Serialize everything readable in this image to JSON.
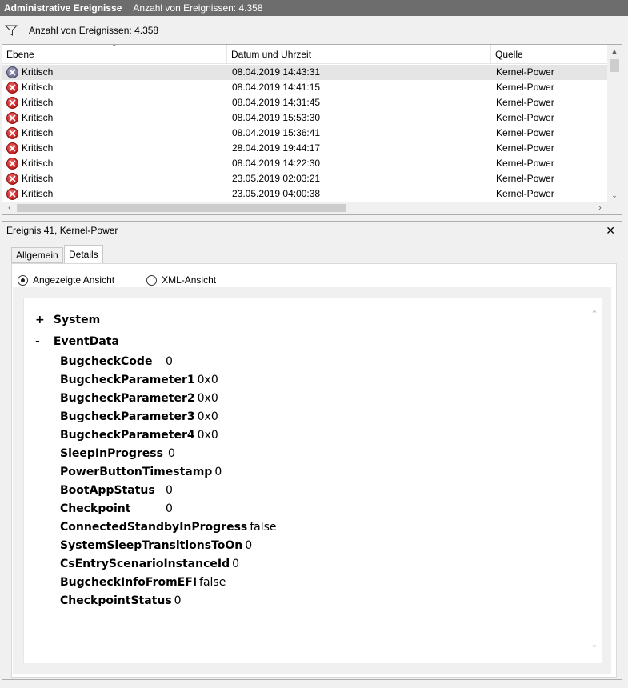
{
  "titlebar": {
    "title": "Administrative Ereignisse",
    "count": "Anzahl von Ereignissen: 4.358"
  },
  "filter": {
    "text": "Anzahl von Ereignissen: 4.358"
  },
  "columns": {
    "level": "Ebene",
    "datetime": "Datum und Uhrzeit",
    "source": "Quelle"
  },
  "rows": [
    {
      "level": "Kritisch",
      "datetime": "08.04.2019 14:43:31",
      "source": "Kernel-Power"
    },
    {
      "level": "Kritisch",
      "datetime": "08.04.2019 14:41:15",
      "source": "Kernel-Power"
    },
    {
      "level": "Kritisch",
      "datetime": "08.04.2019 14:31:45",
      "source": "Kernel-Power"
    },
    {
      "level": "Kritisch",
      "datetime": "08.04.2019 15:53:30",
      "source": "Kernel-Power"
    },
    {
      "level": "Kritisch",
      "datetime": "08.04.2019 15:36:41",
      "source": "Kernel-Power"
    },
    {
      "level": "Kritisch",
      "datetime": "28.04.2019 19:44:17",
      "source": "Kernel-Power"
    },
    {
      "level": "Kritisch",
      "datetime": "08.04.2019 14:22:30",
      "source": "Kernel-Power"
    },
    {
      "level": "Kritisch",
      "datetime": "23.05.2019 02:03:21",
      "source": "Kernel-Power"
    },
    {
      "level": "Kritisch",
      "datetime": "23.05.2019 04:00:38",
      "source": "Kernel-Power"
    }
  ],
  "detail": {
    "header": "Ereignis 41, Kernel-Power",
    "tabs": {
      "general": "Allgemein",
      "details": "Details"
    },
    "radio_friendly": "Angezeigte Ansicht",
    "radio_xml": "XML-Ansicht",
    "tree": {
      "system": {
        "sign": "+",
        "label": "System"
      },
      "eventdata": {
        "sign": "-",
        "label": "EventData"
      }
    },
    "eventdata": [
      {
        "key": "BugcheckCode",
        "value": "0"
      },
      {
        "key": "BugcheckParameter1",
        "value": "0x0"
      },
      {
        "key": "BugcheckParameter2",
        "value": "0x0"
      },
      {
        "key": "BugcheckParameter3",
        "value": "0x0"
      },
      {
        "key": "BugcheckParameter4",
        "value": "0x0"
      },
      {
        "key": "SleepInProgress",
        "value": "0"
      },
      {
        "key": "PowerButtonTimestamp",
        "value": "0"
      },
      {
        "key": "BootAppStatus",
        "value": "0"
      },
      {
        "key": "Checkpoint",
        "value": "0"
      },
      {
        "key": "ConnectedStandbyInProgress",
        "value": "false"
      },
      {
        "key": "SystemSleepTransitionsToOn",
        "value": "0"
      },
      {
        "key": "CsEntryScenarioInstanceId",
        "value": "0"
      },
      {
        "key": "BugcheckInfoFromEFI",
        "value": "false"
      },
      {
        "key": "CheckpointStatus",
        "value": "0"
      }
    ]
  }
}
